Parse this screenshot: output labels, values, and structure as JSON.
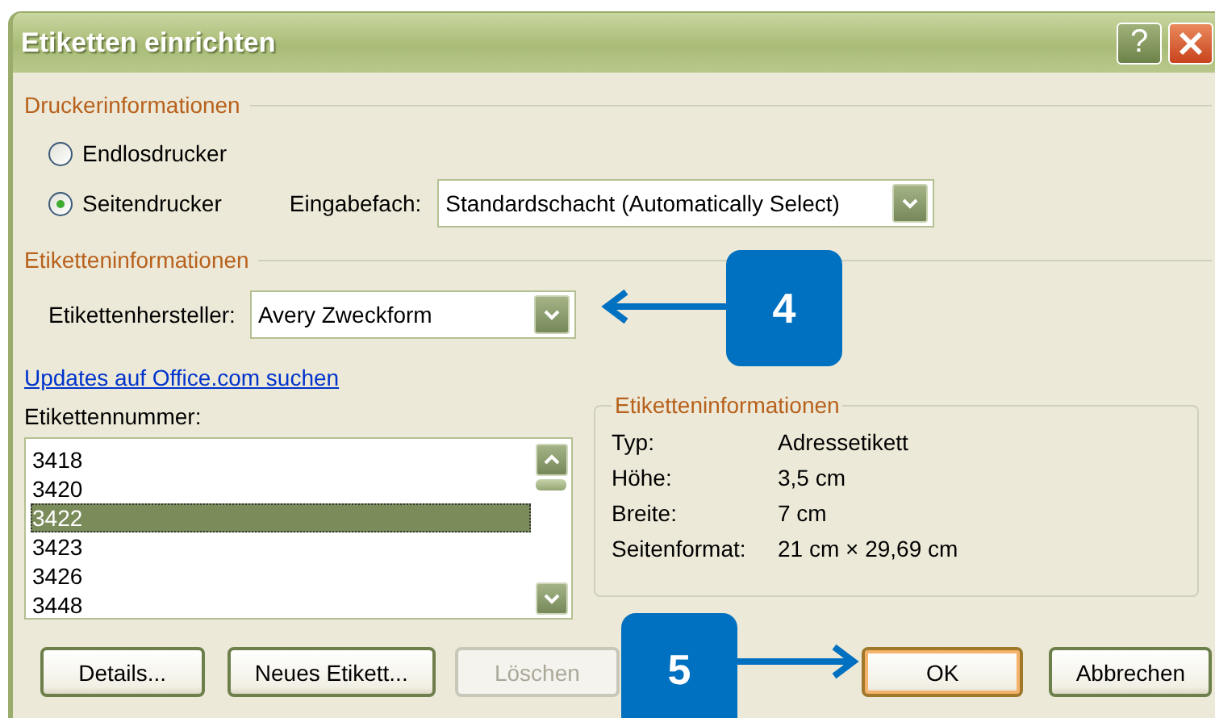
{
  "window": {
    "title": "Etiketten einrichten",
    "help": "?"
  },
  "printer_info": {
    "heading": "Druckerinformationen",
    "options": [
      {
        "label": "Endlosdrucker",
        "selected": false
      },
      {
        "label": "Seitendrucker",
        "selected": true
      }
    ],
    "tray": {
      "label": "Eingabefach:",
      "value": "Standardschacht (Automatically Select)"
    }
  },
  "label_info": {
    "heading": "Etiketteninformationen",
    "vendor": {
      "label": "Etikettenhersteller:",
      "value": "Avery Zweckform"
    }
  },
  "link": "Updates auf Office.com suchen",
  "product_number": {
    "label": "Etikettennummer:",
    "items": [
      {
        "label": "3418",
        "selected": false
      },
      {
        "label": "3420",
        "selected": false
      },
      {
        "label": "3422",
        "selected": true
      },
      {
        "label": "3423",
        "selected": false
      },
      {
        "label": "3426",
        "selected": false
      },
      {
        "label": "3448",
        "selected": false
      }
    ]
  },
  "details": {
    "heading": "Etiketteninformationen",
    "rows": [
      {
        "label": "Typ:",
        "value": "Adressetikett"
      },
      {
        "label": "Höhe:",
        "value": "3,5 cm"
      },
      {
        "label": "Breite:",
        "value": "7 cm"
      },
      {
        "label": "Seitenformat:",
        "value": "21 cm × 29,69 cm"
      }
    ]
  },
  "buttons": [
    {
      "label": "Details...",
      "disabled": false,
      "default": false
    },
    {
      "label": "Neues Etikett...",
      "disabled": false,
      "default": false
    },
    {
      "label": "Löschen",
      "disabled": true,
      "default": false
    },
    {
      "label": "OK",
      "disabled": false,
      "default": true
    },
    {
      "label": "Abbrechen",
      "disabled": false,
      "default": false
    }
  ],
  "callouts": [
    {
      "number": "4"
    },
    {
      "number": "5"
    }
  ]
}
